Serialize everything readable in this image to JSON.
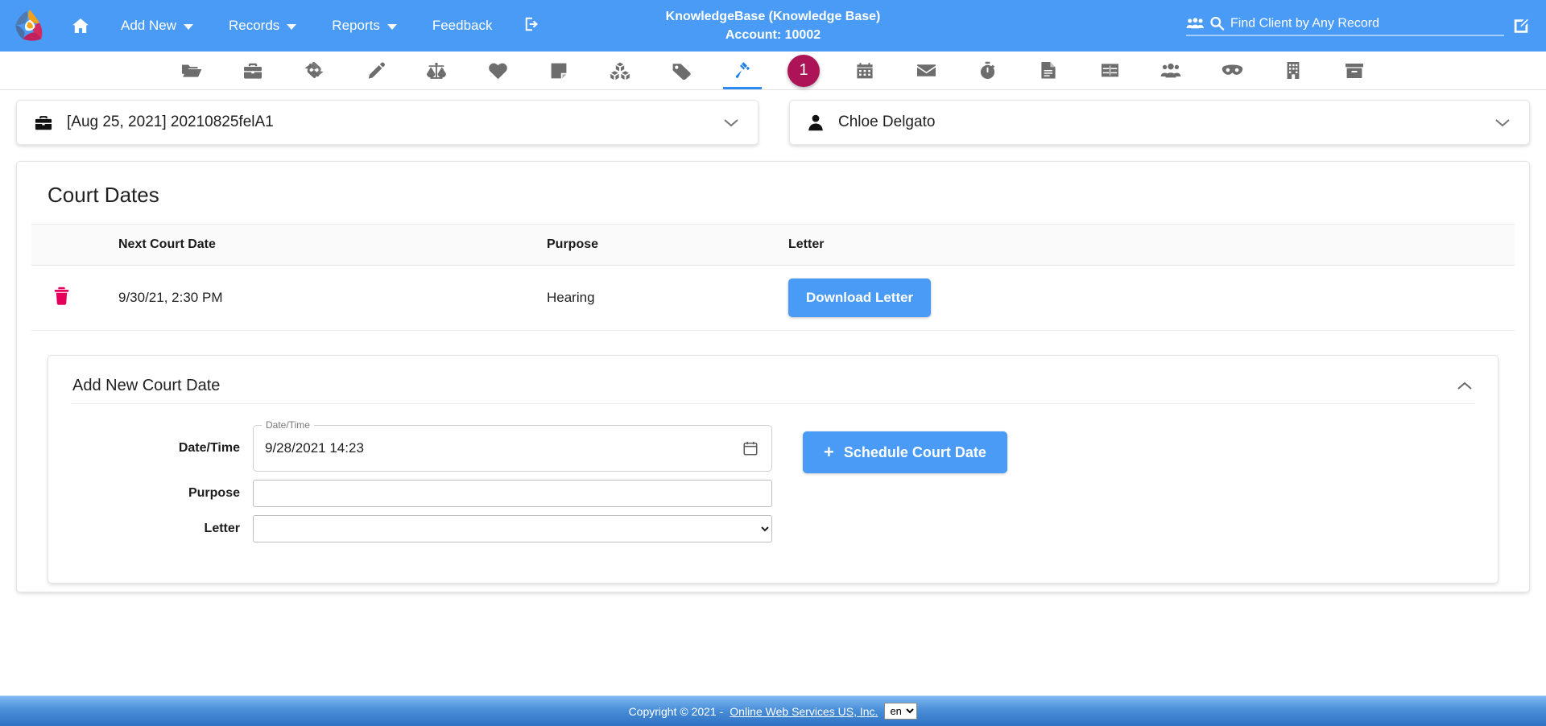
{
  "navbar": {
    "logo_name": "triangle-hands-logo",
    "items": [
      {
        "label": "",
        "icon": "home-icon",
        "has_caret": false,
        "name": "nav-home"
      },
      {
        "label": "Add New",
        "icon": "",
        "has_caret": true,
        "name": "nav-add-new"
      },
      {
        "label": "Records",
        "icon": "",
        "has_caret": true,
        "name": "nav-records"
      },
      {
        "label": "Reports",
        "icon": "",
        "has_caret": true,
        "name": "nav-reports"
      },
      {
        "label": "Feedback",
        "icon": "",
        "has_caret": false,
        "name": "nav-feedback"
      },
      {
        "label": "",
        "icon": "sign-out-icon",
        "has_caret": false,
        "name": "nav-logout"
      }
    ],
    "center": {
      "title": "KnowledgeBase (Knowledge Base)",
      "account": "Account: 10002"
    },
    "search": {
      "placeholder": "Find Client by Any Record",
      "value": "",
      "users_icon": "users-icon",
      "magnifier_icon": "search-icon",
      "edit_icon": "edit-square-icon"
    },
    "bg_color": "#4a9bf5"
  },
  "toolbar": {
    "badge": {
      "text": "1",
      "color": "#ad1457"
    },
    "badge_index": 10,
    "active_index": 9,
    "icons": [
      {
        "name": "folder-open-icon",
        "label": "Folder"
      },
      {
        "name": "briefcase-icon",
        "label": "Cases"
      },
      {
        "name": "handshake-icon",
        "label": "Referrals"
      },
      {
        "name": "pencil-icon",
        "label": "Notes"
      },
      {
        "name": "balance-scale-icon",
        "label": "Legal"
      },
      {
        "name": "heart-icon",
        "label": "Health"
      },
      {
        "name": "sticky-note-icon",
        "label": "Memos"
      },
      {
        "name": "cubes-icon",
        "label": "Programs"
      },
      {
        "name": "tag-icon",
        "label": "Tags"
      },
      {
        "name": "gavel-icon",
        "label": "Court Dates"
      },
      {
        "name": "calendar-icon",
        "label": "Calendar"
      },
      {
        "name": "envelope-icon",
        "label": "Messages"
      },
      {
        "name": "stopwatch-icon",
        "label": "Time"
      },
      {
        "name": "file-alt-icon",
        "label": "Documents"
      },
      {
        "name": "table-icon",
        "label": "Tables"
      },
      {
        "name": "users-group-icon",
        "label": "Contacts"
      },
      {
        "name": "mask-icon",
        "label": "Anonymous"
      },
      {
        "name": "building-icon",
        "label": "Agency"
      },
      {
        "name": "archive-box-icon",
        "label": "Archive"
      }
    ]
  },
  "case_bar": {
    "icon": "briefcase-icon",
    "text": "[Aug 25, 2021] 20210825felA1",
    "chevron": "chevron-down-icon"
  },
  "client_bar": {
    "icon": "user-icon",
    "text": "Chloe Delgato",
    "chevron": "chevron-down-icon"
  },
  "court_dates": {
    "title": "Court Dates",
    "columns": [
      "",
      "Next Court Date",
      "Purpose",
      "Letter"
    ],
    "rows": [
      {
        "delete_icon": "trash-icon",
        "next_court_date": "9/30/21, 2:30 PM",
        "purpose": "Hearing",
        "letter_button": "Download Letter"
      }
    ]
  },
  "add_court_date": {
    "title": "Add New Court Date",
    "collapse_icon": "chevron-up-icon",
    "datetime": {
      "label": "Date/Time",
      "legend": "Date/Time",
      "value": "9/28/2021 14:23",
      "calendar_icon": "calendar-picker-icon"
    },
    "purpose": {
      "label": "Purpose",
      "value": "",
      "placeholder": ""
    },
    "letter": {
      "label": "Letter",
      "selected": "",
      "options": [
        ""
      ]
    },
    "submit": {
      "label": "Schedule Court Date",
      "plus": "+"
    }
  },
  "footer": {
    "copyright": "Copyright © 2021 -",
    "link": "Online Web Services US, Inc.",
    "language": {
      "selected": "en",
      "options": [
        "en"
      ]
    }
  }
}
